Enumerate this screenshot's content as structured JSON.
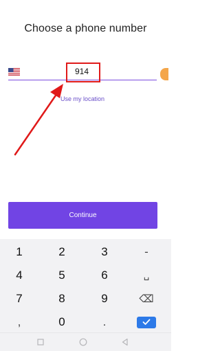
{
  "screen": {
    "title": "Choose a phone number"
  },
  "phone": {
    "country_flag": "us-flag-icon",
    "value": "914",
    "use_location_label": "Use my location",
    "underline_color": "#7a4bdf"
  },
  "annotation": {
    "color": "#e01919"
  },
  "continue_button": {
    "label": "Continue",
    "color": "#7144e4"
  },
  "keyboard": {
    "keys": [
      "1",
      "2",
      "3",
      "-",
      "4",
      "5",
      "6",
      "␣",
      "7",
      "8",
      "9",
      "⌫",
      ",",
      "0",
      ".",
      "✓"
    ]
  },
  "navbar": {
    "icons": [
      "recents-square-icon",
      "home-circle-icon",
      "back-triangle-icon"
    ]
  }
}
